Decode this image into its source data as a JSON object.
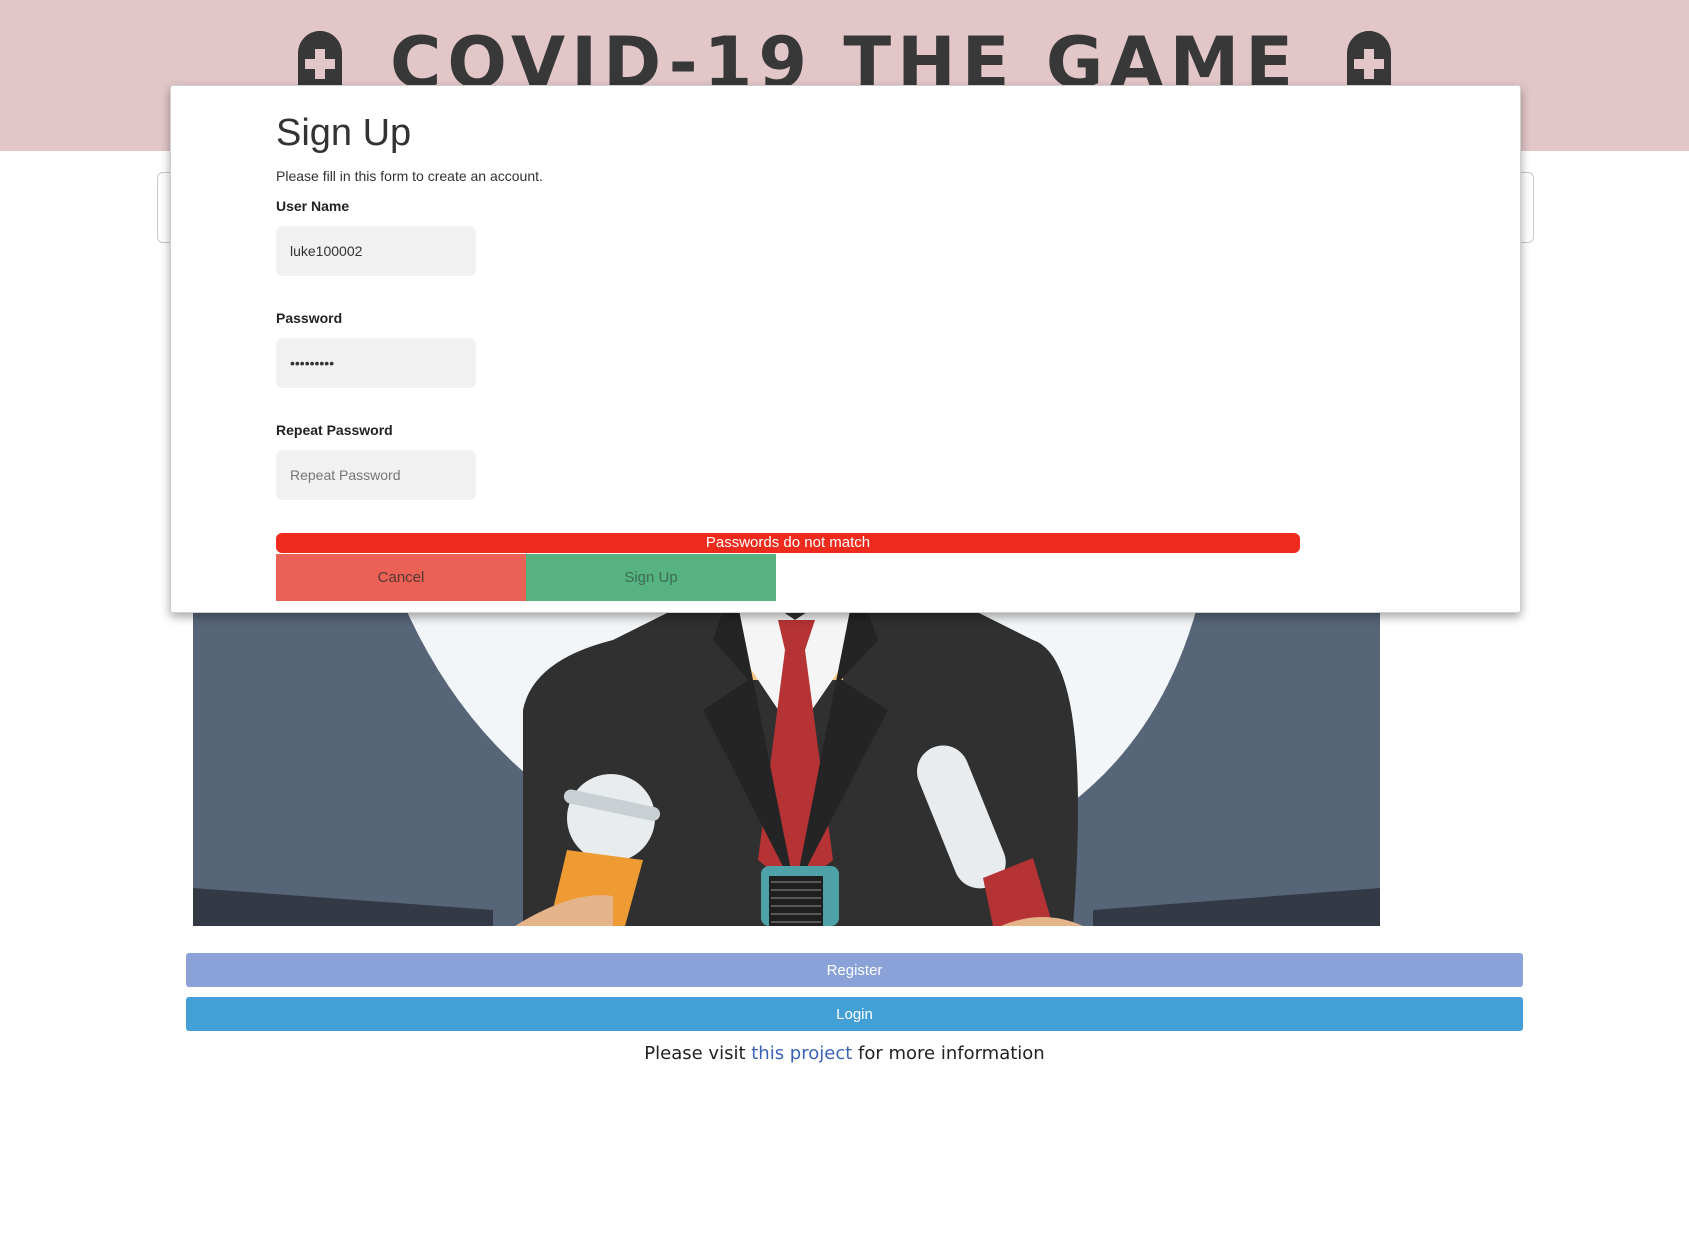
{
  "header": {
    "title": "COVID-19 THE GAME"
  },
  "icons": {
    "title_left": "tombstone-cross-icon",
    "title_right": "tombstone-cross-icon"
  },
  "actions": {
    "register_label": "Register",
    "login_label": "Login"
  },
  "footer": {
    "prefix": "Please visit ",
    "link_text": "this project",
    "suffix": " for more information"
  },
  "modal": {
    "title": "Sign Up",
    "subtitle": "Please fill in this form to create an account.",
    "username": {
      "label": "User Name",
      "value": "luke100002"
    },
    "password": {
      "label": "Password",
      "value": "•••••••••"
    },
    "repeat_password": {
      "label": "Repeat Password",
      "placeholder": "Repeat Password",
      "value": ""
    },
    "error": "Passwords do not match",
    "cancel_label": "Cancel",
    "signup_label": "Sign Up"
  },
  "colors": {
    "header_band": "#e3c7c8",
    "register": "#8aa2d8",
    "login": "#42a0d6",
    "error": "#ef2b1d",
    "cancel": "#eb6155",
    "signup": "#56b37f",
    "link": "#3a63b6"
  }
}
